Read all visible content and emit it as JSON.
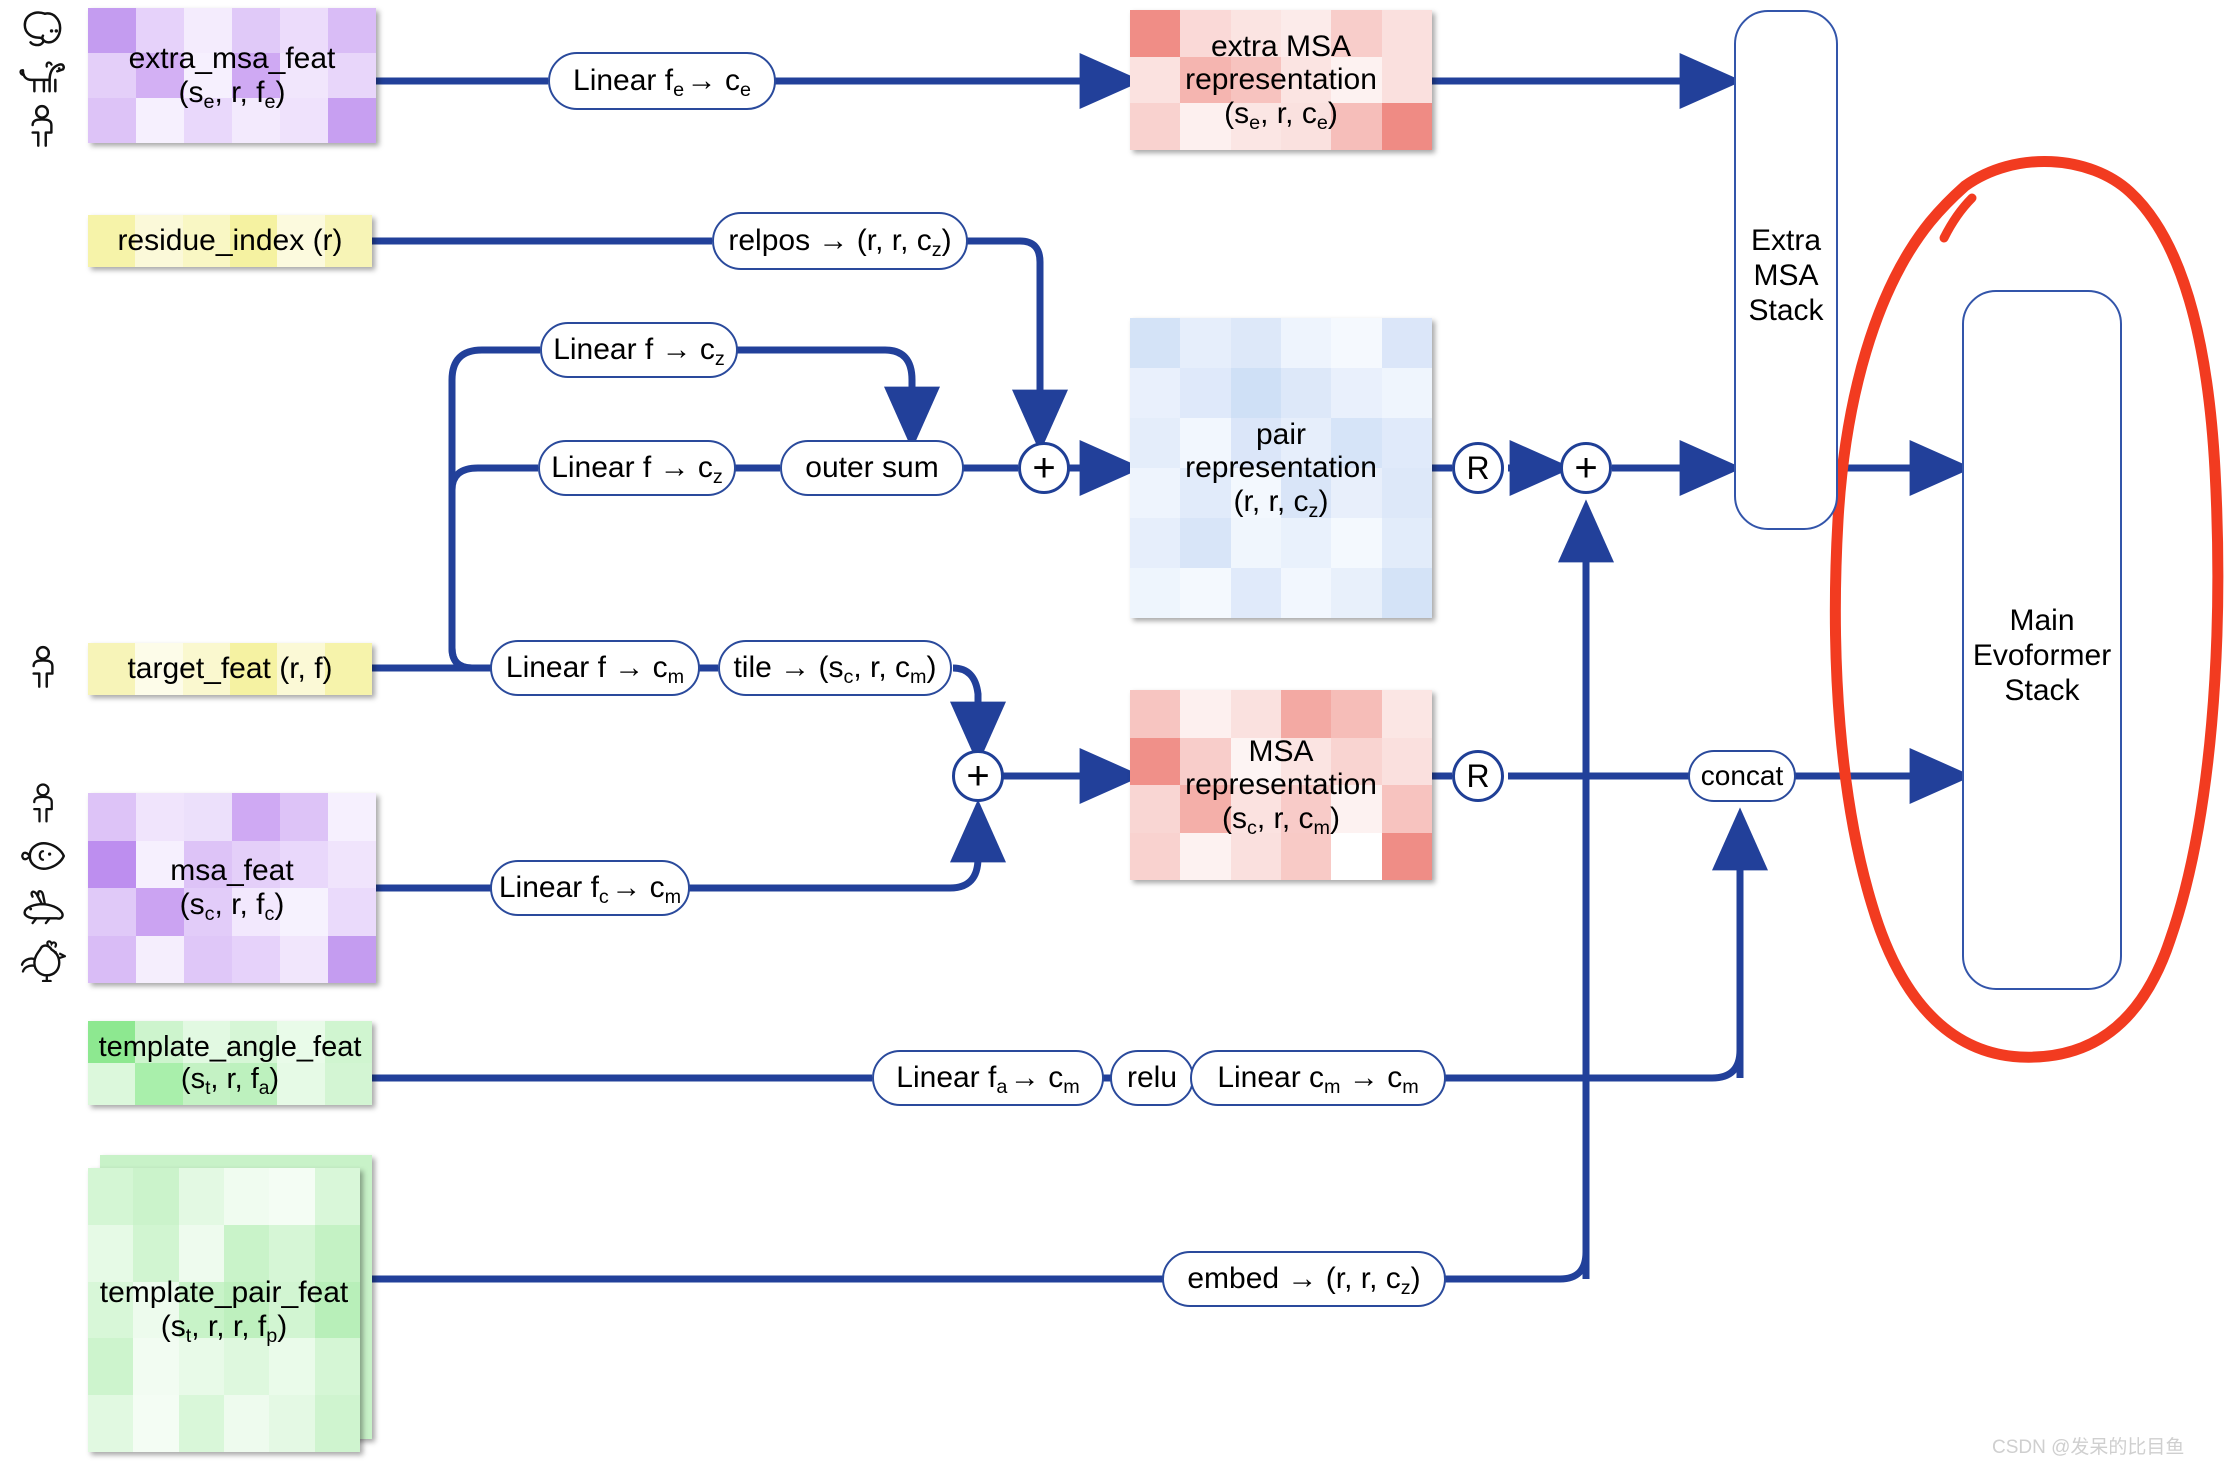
{
  "diagram": {
    "title": "AlphaFold input feature embedding diagram",
    "line_color": "#22409a",
    "pill_border_color": "#2a4a9c",
    "annotation_color": "#f23b20",
    "watermark": "CSDN @发呆的比目鱼"
  },
  "features": [
    {
      "id": "extra_msa_feat",
      "name": "extra_msa_feat",
      "shape": "(sₑ, r, fₑ)",
      "color": "#c9a3f0",
      "icons": [
        "snake-icon",
        "dog-icon",
        "human-icon"
      ]
    },
    {
      "id": "residue_index",
      "name": "residue_index (r)",
      "shape": "",
      "color": "#f7f6b4",
      "icons": []
    },
    {
      "id": "target_feat",
      "name": "target_feat (r, f)",
      "shape": "",
      "color": "#f7f6b4",
      "icons": [
        "human-icon"
      ]
    },
    {
      "id": "msa_feat",
      "name": "msa_feat",
      "shape": "(s_c, r, f_c)",
      "color": "#c9a3f0",
      "icons": [
        "human-icon",
        "fish-icon",
        "rabbit-icon",
        "chicken-icon"
      ]
    },
    {
      "id": "template_angle_feat",
      "name": "template_angle_feat",
      "shape": "(s_t, r, f_a)",
      "color": "#a9ebaa",
      "icons": []
    },
    {
      "id": "template_pair_feat",
      "name": "template_pair_feat",
      "shape": "(s_t, r, r, f_p)",
      "color": "#a9ebaa",
      "icons": []
    }
  ],
  "representations": [
    {
      "id": "extra_msa_rep",
      "name": "extra MSA\nrepresentation",
      "line1": "extra MSA",
      "line2": "representation",
      "shape": "(s_e, r, c_e)",
      "color": "#f5a7a2"
    },
    {
      "id": "pair_rep",
      "line1": "pair",
      "line2": "representation",
      "shape": "(r, r, c_z)",
      "color": "#c3d8f2"
    },
    {
      "id": "msa_rep",
      "line1": "MSA",
      "line2": "representation",
      "shape": "(s_c, r, c_m)",
      "color": "#f5a7a2"
    }
  ],
  "ops": {
    "linear_fe_ce": {
      "label": "Linear f_e→ c_e",
      "pre": "Linear f",
      "sub1": "e",
      "mid": " → c",
      "sub2": "e"
    },
    "relpos": {
      "label": "relpos → (r, r, c_z)"
    },
    "linear_f_cz_top": {
      "label": "Linear f → c_z"
    },
    "linear_f_cz_bottom": {
      "label": "Linear f → c_z"
    },
    "outer_sum": {
      "label": "outer sum"
    },
    "linear_f_cm": {
      "label": "Linear f → c_m"
    },
    "tile": {
      "label": "tile → (s_c, r, c_m)"
    },
    "linear_fc_cm": {
      "label": "Linear f_c→ c_m"
    },
    "linear_fa_cm": {
      "label": "Linear f_a→ c_m"
    },
    "relu": {
      "label": "relu"
    },
    "linear_cm_cm": {
      "label": "Linear c_m → c_m"
    },
    "embed": {
      "label": "embed → (r, r, c_z)"
    },
    "concat": {
      "label": "concat"
    },
    "plus_pair": {
      "label": "+"
    },
    "plus_msa": {
      "label": "+"
    },
    "plus_recycle": {
      "label": "+"
    },
    "recycle_pair": {
      "label": "R"
    },
    "recycle_msa": {
      "label": "R"
    }
  },
  "stacks": [
    {
      "id": "extra_msa_stack",
      "lines": [
        "Extra",
        "MSA",
        "Stack"
      ]
    },
    {
      "id": "main_evoformer_stack",
      "lines": [
        "Main",
        "Evoformer",
        "Stack"
      ]
    }
  ]
}
